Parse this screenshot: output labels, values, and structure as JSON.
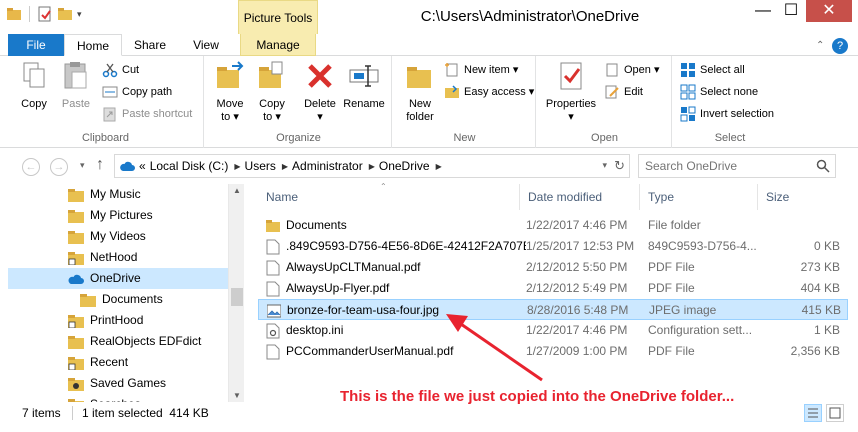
{
  "window": {
    "title": "C:\\Users\\Administrator\\OneDrive",
    "contextual_tab_group": "Picture Tools",
    "controls": {
      "minimize": "—",
      "maximize": "☐",
      "close": "✕"
    }
  },
  "ribbon_tabs": {
    "file": "File",
    "home": "Home",
    "share": "Share",
    "view": "View",
    "manage": "Manage",
    "help": "?"
  },
  "ribbon": {
    "clipboard": {
      "label": "Clipboard",
      "copy": "Copy",
      "paste": "Paste",
      "cut": "Cut",
      "copy_path": "Copy path",
      "paste_shortcut": "Paste shortcut"
    },
    "organize": {
      "label": "Organize",
      "move_to": "Move",
      "move_to_2": "to ▾",
      "copy_to": "Copy",
      "copy_to_2": "to ▾",
      "delete": "Delete",
      "delete_2": "▾",
      "rename": "Rename"
    },
    "new": {
      "label": "New",
      "new_folder": "New",
      "new_folder_2": "folder",
      "new_item": "New item ▾",
      "easy_access": "Easy access ▾"
    },
    "open": {
      "label": "Open",
      "properties": "Properties",
      "properties_2": "▾",
      "open": "Open ▾",
      "edit": "Edit"
    },
    "select": {
      "label": "Select",
      "select_all": "Select all",
      "select_none": "Select none",
      "invert_selection": "Invert selection"
    }
  },
  "address": {
    "prefix": "«",
    "crumbs": [
      "Local Disk (C:)",
      "Users",
      "Administrator",
      "OneDrive"
    ],
    "search_placeholder": "Search OneDrive"
  },
  "nav_pane": {
    "items": [
      {
        "label": "My Music",
        "icon": "music-folder-icon"
      },
      {
        "label": "My Pictures",
        "icon": "pictures-folder-icon"
      },
      {
        "label": "My Videos",
        "icon": "videos-folder-icon"
      },
      {
        "label": "NetHood",
        "icon": "shortcut-folder-icon"
      },
      {
        "label": "OneDrive",
        "icon": "onedrive-cloud-icon"
      },
      {
        "label": "Documents",
        "icon": "folder-icon"
      },
      {
        "label": "PrintHood",
        "icon": "shortcut-folder-icon"
      },
      {
        "label": "RealObjects EDFdict",
        "icon": "folder-icon"
      },
      {
        "label": "Recent",
        "icon": "shortcut-folder-icon"
      },
      {
        "label": "Saved Games",
        "icon": "saved-games-folder-icon"
      },
      {
        "label": "Searches",
        "icon": "searches-folder-icon"
      }
    ],
    "selected_index": 4
  },
  "file_list": {
    "columns": {
      "name": "Name",
      "date": "Date modified",
      "type": "Type",
      "size": "Size"
    },
    "rows": [
      {
        "name": "Documents",
        "date": "1/22/2017 4:46 PM",
        "type": "File folder",
        "size": "",
        "icon": "folder"
      },
      {
        "name": ".849C9593-D756-4E56-8D6E-42412F2A707B",
        "date": "1/25/2017 12:53 PM",
        "type": "849C9593-D756-4...",
        "size": "0 KB",
        "icon": "file"
      },
      {
        "name": "AlwaysUpCLTManual.pdf",
        "date": "2/12/2012 5:50 PM",
        "type": "PDF File",
        "size": "273 KB",
        "icon": "file"
      },
      {
        "name": "AlwaysUp-Flyer.pdf",
        "date": "2/12/2012 5:49 PM",
        "type": "PDF File",
        "size": "404 KB",
        "icon": "file"
      },
      {
        "name": "bronze-for-team-usa-four.jpg",
        "date": "8/28/2016 5:48 PM",
        "type": "JPEG image",
        "size": "415 KB",
        "icon": "image"
      },
      {
        "name": "desktop.ini",
        "date": "1/22/2017 4:46 PM",
        "type": "Configuration sett...",
        "size": "1 KB",
        "icon": "ini"
      },
      {
        "name": "PCCommanderUserManual.pdf",
        "date": "1/27/2009 1:00 PM",
        "type": "PDF File",
        "size": "2,356 KB",
        "icon": "file"
      }
    ],
    "selected_index": 4
  },
  "status": {
    "items_count": "7 items",
    "selection": "1 item selected  414 KB"
  },
  "annotation": {
    "text": "This is the file we just copied into the OneDrive folder..."
  },
  "colors": {
    "accent": "#1979ca",
    "selection_bg": "#cce8ff",
    "picture_tools": "#f8ecb0",
    "close_red": "#c7504a",
    "annotation_red": "#e8232f"
  }
}
